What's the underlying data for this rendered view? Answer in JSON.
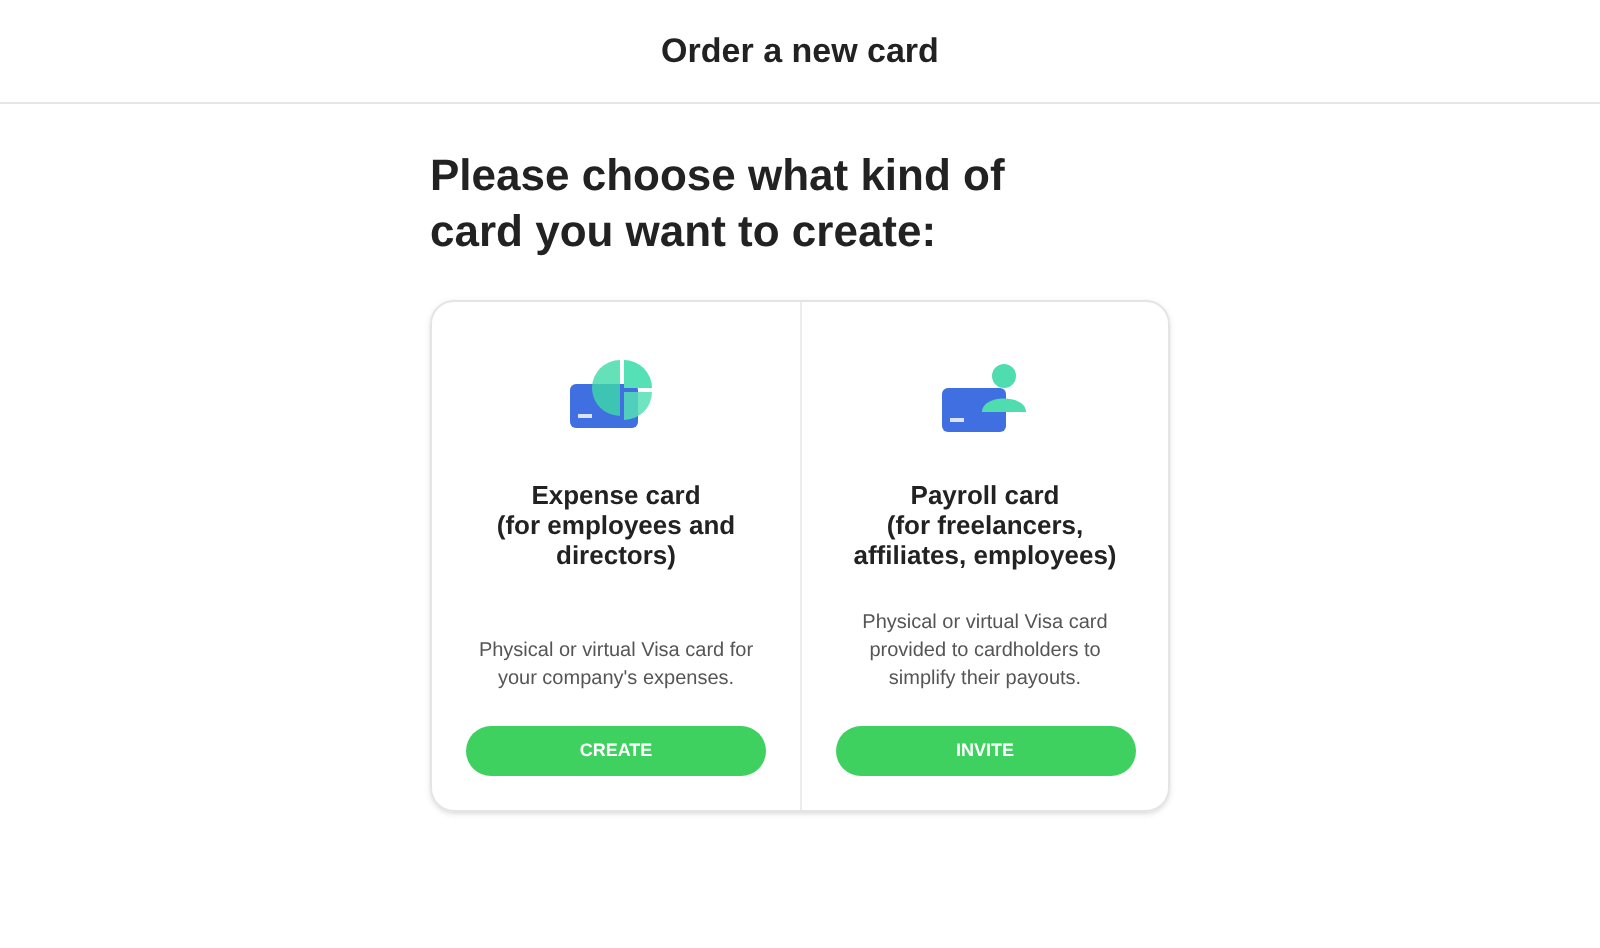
{
  "header": {
    "title": "Order a new card"
  },
  "heading": "Please choose what kind of card you want to create:",
  "options": [
    {
      "kind": "expense",
      "title": "Expense card\n(for employees and\ndirectors)",
      "description": "Physical or virtual Visa card for your company's expenses.",
      "button": "CREATE"
    },
    {
      "kind": "payroll",
      "title": "Payroll card\n(for freelancers,\naffiliates, employees)",
      "description": "Physical or virtual Visa card provided to cardholders to simplify their payouts.",
      "button": "INVITE"
    }
  ]
}
